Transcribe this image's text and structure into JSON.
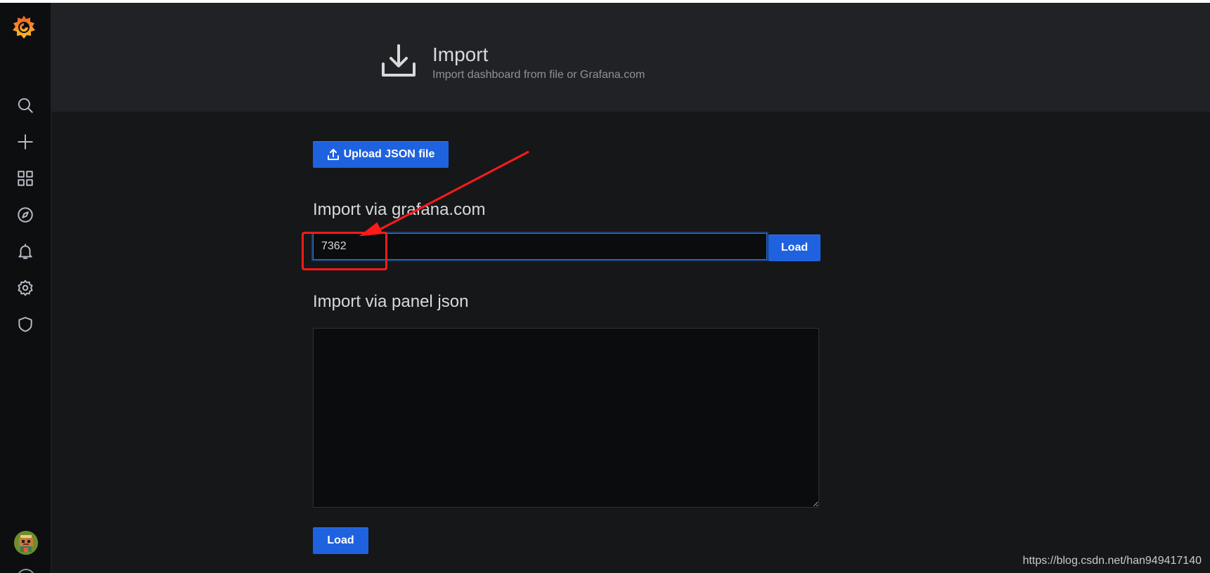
{
  "header": {
    "title": "Import",
    "subtitle": "Import dashboard from file or Grafana.com",
    "icon": "download-icon"
  },
  "sidebar": {
    "items": [
      {
        "name": "search",
        "icon": "search-icon"
      },
      {
        "name": "create",
        "icon": "plus-icon"
      },
      {
        "name": "dashboards",
        "icon": "apps-icon"
      },
      {
        "name": "explore",
        "icon": "compass-icon"
      },
      {
        "name": "alerting",
        "icon": "bell-icon"
      },
      {
        "name": "configuration",
        "icon": "gear-icon"
      },
      {
        "name": "server-admin",
        "icon": "shield-icon"
      }
    ]
  },
  "upload": {
    "label": "Upload JSON file",
    "icon": "upload-icon"
  },
  "grafana_com": {
    "title": "Import via grafana.com",
    "input_value": "7362",
    "load_label": "Load"
  },
  "panel_json": {
    "title": "Import via panel json",
    "value": "",
    "load_label": "Load"
  },
  "watermark": "https://blog.csdn.net/han949417140",
  "colors": {
    "primary_button": "#1f62e0",
    "background": "#161719",
    "header_background": "#202226",
    "sidebar_background": "#0d0e10",
    "annotation": "#ff1a1a"
  }
}
